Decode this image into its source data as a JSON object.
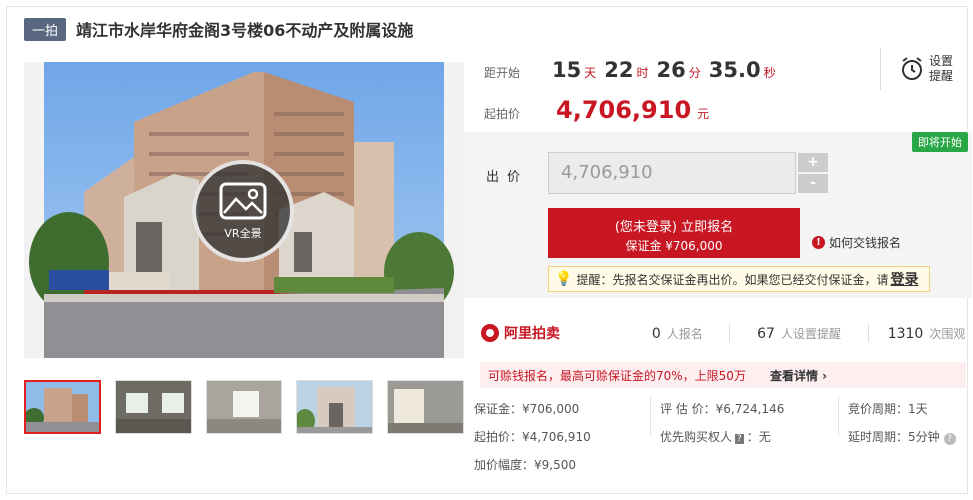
{
  "header": {
    "tag": "一拍",
    "title": "靖江市水岸华府金阁3号楼06不动产及附属设施"
  },
  "gallery": {
    "vr_label": "VR全景",
    "thumb_count": 5
  },
  "countdown": {
    "label": "距开始",
    "days": "15",
    "days_unit": "天",
    "hours": "22",
    "hours_unit": "时",
    "minutes": "26",
    "minutes_unit": "分",
    "seconds": "35.0",
    "seconds_unit": "秒"
  },
  "reminder": {
    "label": "设置提醒"
  },
  "start_price": {
    "label": "起拍价",
    "value": "4,706,910",
    "unit": "元"
  },
  "bid": {
    "status": "即将开始",
    "label": "出价",
    "value": "4,706,910",
    "plus": "+",
    "minus": "-",
    "signup_line1": "(您未登录) 立即报名",
    "signup_line2": "保证金 ¥706,000",
    "howto": "如何交钱报名",
    "tip": "提醒：先报名交保证金再出价。如果您已经交付保证金，请",
    "tip_login": "登录"
  },
  "platform": {
    "name": "阿里拍卖",
    "signups": "0",
    "signups_unit": "人报名",
    "reminders": "67",
    "reminders_unit": "人设置提醒",
    "views": "1310",
    "views_unit": "次围观"
  },
  "risk": {
    "message": "可赊钱报名，最高可赊保证金的70%，上限50万",
    "more": "查看详情"
  },
  "details": {
    "deposit": "保证金：¥706,000",
    "appraisal": "评 估 价：¥6,724,146",
    "period": "竞价周期：1天",
    "start": "起拍价：¥4,706,910",
    "priority_label": "优先购买权人",
    "priority_tag": "?",
    "priority_value": "：无",
    "delay": "延时周期：5分钟",
    "increment": "加价幅度：¥9,500"
  },
  "colors": {
    "accent_red": "#c81623",
    "status_green": "#27a745",
    "tag_bg": "#5a6780"
  }
}
